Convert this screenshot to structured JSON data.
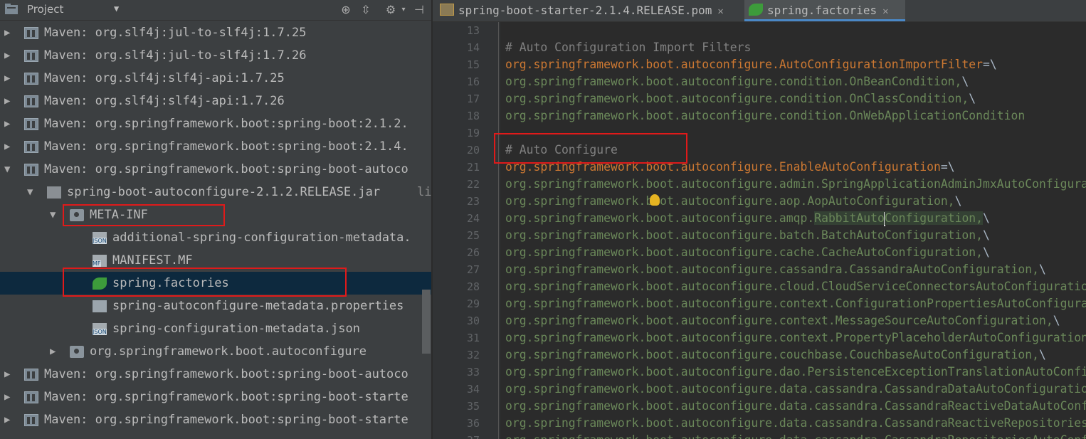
{
  "project_panel": {
    "title": "Project",
    "tree": [
      {
        "label": "Maven: org.slf4j:jul-to-slf4j:1.7.25",
        "level": 0,
        "expanded": false,
        "icon": "library-icon"
      },
      {
        "label": "Maven: org.slf4j:jul-to-slf4j:1.7.26",
        "level": 0,
        "expanded": false,
        "icon": "library-icon"
      },
      {
        "label": "Maven: org.slf4j:slf4j-api:1.7.25",
        "level": 0,
        "expanded": false,
        "icon": "library-icon"
      },
      {
        "label": "Maven: org.slf4j:slf4j-api:1.7.26",
        "level": 0,
        "expanded": false,
        "icon": "library-icon"
      },
      {
        "label": "Maven: org.springframework.boot:spring-boot:2.1.2.",
        "level": 0,
        "expanded": false,
        "icon": "library-icon"
      },
      {
        "label": "Maven: org.springframework.boot:spring-boot:2.1.4.",
        "level": 0,
        "expanded": false,
        "icon": "library-icon"
      },
      {
        "label": "Maven: org.springframework.boot:spring-boot-autoco",
        "level": 0,
        "expanded": true,
        "icon": "library-icon"
      },
      {
        "label": "spring-boot-autoconfigure-2.1.2.RELEASE.jar",
        "suffix": "li",
        "level": 1,
        "expanded": true,
        "icon": "jar-icon"
      },
      {
        "label": "META-INF",
        "level": 2,
        "expanded": true,
        "icon": "package-icon"
      },
      {
        "label": "additional-spring-configuration-metadata.",
        "level": 3,
        "icon": "json-file-icon"
      },
      {
        "label": "MANIFEST.MF",
        "level": 3,
        "icon": "manifest-file-icon"
      },
      {
        "label": "spring.factories",
        "level": 3,
        "icon": "spring-file-icon",
        "selected": true
      },
      {
        "label": "spring-autoconfigure-metadata.properties",
        "level": 3,
        "icon": "properties-file-icon"
      },
      {
        "label": "spring-configuration-metadata.json",
        "level": 3,
        "icon": "json-file-icon"
      },
      {
        "label": "org.springframework.boot.autoconfigure",
        "level": 2,
        "expanded": false,
        "icon": "package-icon"
      },
      {
        "label": "Maven: org.springframework.boot:spring-boot-autoco",
        "level": 0,
        "expanded": false,
        "icon": "library-icon"
      },
      {
        "label": "Maven: org.springframework.boot:spring-boot-starte",
        "level": 0,
        "expanded": false,
        "icon": "library-icon"
      },
      {
        "label": "Maven: org.springframework.boot:spring-boot-starte",
        "level": 0,
        "expanded": false,
        "icon": "library-icon"
      }
    ]
  },
  "editor": {
    "tabs": [
      {
        "label": "spring-boot-starter-2.1.4.RELEASE.pom",
        "active": false
      },
      {
        "label": "spring.factories",
        "active": true
      }
    ],
    "lines": [
      {
        "num": "13",
        "parts": []
      },
      {
        "num": "14",
        "parts": [
          {
            "t": "# Auto Configuration Import Filters",
            "c": "comment"
          }
        ]
      },
      {
        "num": "15",
        "parts": [
          {
            "t": "org.springframework.boot.autoconfigure.AutoConfigurationImportFilter",
            "c": "key"
          },
          {
            "t": "=\\",
            "c": "bs"
          }
        ]
      },
      {
        "num": "16",
        "parts": [
          {
            "t": "org.springframework.boot.autoconfigure.condition.OnBeanCondition,",
            "c": "val"
          },
          {
            "t": "\\",
            "c": "bs"
          }
        ]
      },
      {
        "num": "17",
        "parts": [
          {
            "t": "org.springframework.boot.autoconfigure.condition.OnClassCondition,",
            "c": "val"
          },
          {
            "t": "\\",
            "c": "bs"
          }
        ]
      },
      {
        "num": "18",
        "parts": [
          {
            "t": "org.springframework.boot.autoconfigure.condition.OnWebApplicationCondition",
            "c": "val"
          }
        ]
      },
      {
        "num": "19",
        "parts": []
      },
      {
        "num": "20",
        "parts": [
          {
            "t": "# Auto Configure",
            "c": "comment"
          }
        ]
      },
      {
        "num": "21",
        "parts": [
          {
            "t": "org.springframework.boot.autoconfigure.EnableAutoConfiguration",
            "c": "key"
          },
          {
            "t": "=\\",
            "c": "bs"
          }
        ]
      },
      {
        "num": "22",
        "parts": [
          {
            "t": "org.springframework.boot.autoconfigure.admin.SpringApplicationAdminJmxAutoConfiguration,",
            "c": "val"
          },
          {
            "t": "\\",
            "c": "bs"
          }
        ]
      },
      {
        "num": "23",
        "parts": [
          {
            "t": "org.springframework.boot.autoconfigure.aop.AopAutoConfiguration,",
            "c": "val"
          },
          {
            "t": "\\",
            "c": "bs"
          }
        ]
      },
      {
        "num": "24",
        "parts": [
          {
            "t": "org.springframework.boot.autoconfigure.amqp.",
            "c": "val"
          },
          {
            "t": "RabbitAuto",
            "c": "val-hl"
          },
          {
            "t": "",
            "c": "caret"
          },
          {
            "t": "Configuration,",
            "c": "val-hl"
          },
          {
            "t": "\\",
            "c": "bs"
          }
        ]
      },
      {
        "num": "25",
        "parts": [
          {
            "t": "org.springframework.boot.autoconfigure.batch.BatchAutoConfiguration,",
            "c": "val"
          },
          {
            "t": "\\",
            "c": "bs"
          }
        ]
      },
      {
        "num": "26",
        "parts": [
          {
            "t": "org.springframework.boot.autoconfigure.cache.CacheAutoConfiguration,",
            "c": "val"
          },
          {
            "t": "\\",
            "c": "bs"
          }
        ]
      },
      {
        "num": "27",
        "parts": [
          {
            "t": "org.springframework.boot.autoconfigure.cassandra.CassandraAutoConfiguration,",
            "c": "val"
          },
          {
            "t": "\\",
            "c": "bs"
          }
        ]
      },
      {
        "num": "28",
        "parts": [
          {
            "t": "org.springframework.boot.autoconfigure.cloud.CloudServiceConnectorsAutoConfiguration,",
            "c": "val"
          },
          {
            "t": "\\",
            "c": "bs"
          }
        ]
      },
      {
        "num": "29",
        "parts": [
          {
            "t": "org.springframework.boot.autoconfigure.context.ConfigurationPropertiesAutoConfiguration,",
            "c": "val"
          },
          {
            "t": "\\",
            "c": "bs"
          }
        ]
      },
      {
        "num": "30",
        "parts": [
          {
            "t": "org.springframework.boot.autoconfigure.context.MessageSourceAutoConfiguration,",
            "c": "val"
          },
          {
            "t": "\\",
            "c": "bs"
          }
        ]
      },
      {
        "num": "31",
        "parts": [
          {
            "t": "org.springframework.boot.autoconfigure.context.PropertyPlaceholderAutoConfiguration,",
            "c": "val"
          },
          {
            "t": "\\",
            "c": "bs"
          }
        ]
      },
      {
        "num": "32",
        "parts": [
          {
            "t": "org.springframework.boot.autoconfigure.couchbase.CouchbaseAutoConfiguration,",
            "c": "val"
          },
          {
            "t": "\\",
            "c": "bs"
          }
        ]
      },
      {
        "num": "33",
        "parts": [
          {
            "t": "org.springframework.boot.autoconfigure.dao.PersistenceExceptionTranslationAutoConfiguration,",
            "c": "val"
          },
          {
            "t": "\\",
            "c": "bs"
          }
        ]
      },
      {
        "num": "34",
        "parts": [
          {
            "t": "org.springframework.boot.autoconfigure.data.cassandra.CassandraDataAutoConfiguration,",
            "c": "val"
          },
          {
            "t": "\\",
            "c": "bs"
          }
        ]
      },
      {
        "num": "35",
        "parts": [
          {
            "t": "org.springframework.boot.autoconfigure.data.cassandra.CassandraReactiveDataAutoConfiguration,",
            "c": "val"
          },
          {
            "t": "\\",
            "c": "bs"
          }
        ]
      },
      {
        "num": "36",
        "parts": [
          {
            "t": "org.springframework.boot.autoconfigure.data.cassandra.CassandraReactiveRepositoriesAutoConfiguration,",
            "c": "val"
          },
          {
            "t": "\\",
            "c": "bs"
          }
        ]
      },
      {
        "num": "37",
        "parts": [
          {
            "t": "org.springframework.boot.autoconfigure.data.cassandra.CassandraRepositoriesAutoConfiguration,",
            "c": "val"
          },
          {
            "t": "\\",
            "c": "bs"
          }
        ]
      }
    ]
  },
  "colors": {
    "highlight_box": "#e01a1a",
    "selection": "#0d293e",
    "comment": "#808080",
    "key": "#cc7832",
    "value": "#6a8759"
  }
}
